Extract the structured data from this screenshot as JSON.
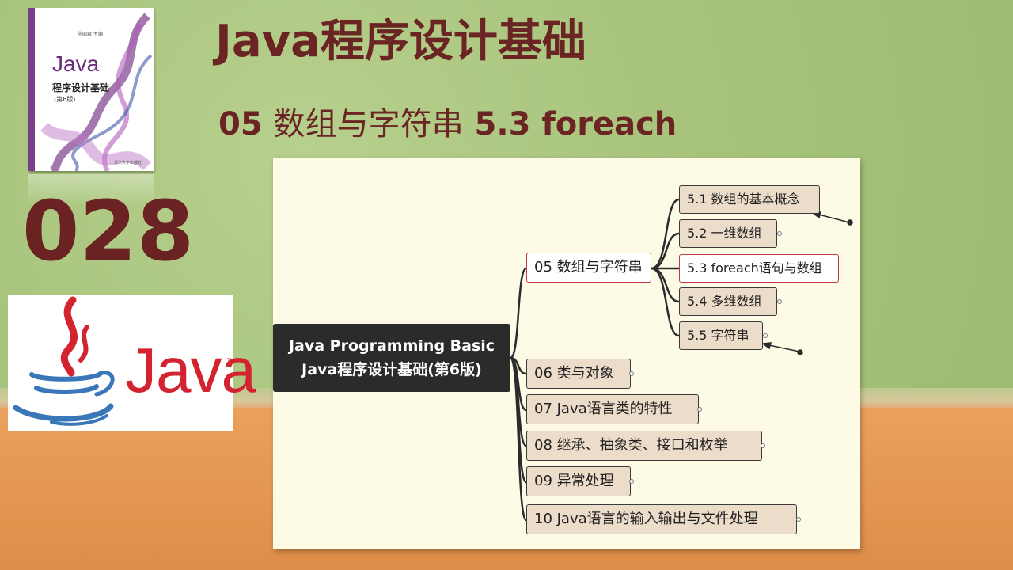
{
  "title": "Java程序设计基础",
  "subtitle": {
    "chapter": "05",
    "name": "数组与字符串",
    "section": "5.3 foreach"
  },
  "episode_number": "028",
  "book": {
    "brand": "Java",
    "title": "程序设计基础",
    "edition": "(第6版)"
  },
  "java_logo": {
    "text": "Java",
    "tm": "TM"
  },
  "mindmap": {
    "root": {
      "line1": "Java Programming Basic",
      "line2": "Java程序设计基础(第6版)"
    },
    "chapters": [
      "05 数组与字符串",
      "06 类与对象",
      "07 Java语言类的特性",
      "08 继承、抽象类、接口和枚举",
      "09 异常处理",
      "10 Java语言的输入输出与文件处理"
    ],
    "sections": [
      "5.1 数组的基本概念",
      "5.2 一维数组",
      "5.3 foreach语句与数组",
      "5.4 多维数组",
      "5.5 字符串"
    ]
  },
  "colors": {
    "title": "#6b2424",
    "java_red": "#d3232f",
    "java_blue": "#3a77b8",
    "selected_border": "#c03a4a"
  }
}
